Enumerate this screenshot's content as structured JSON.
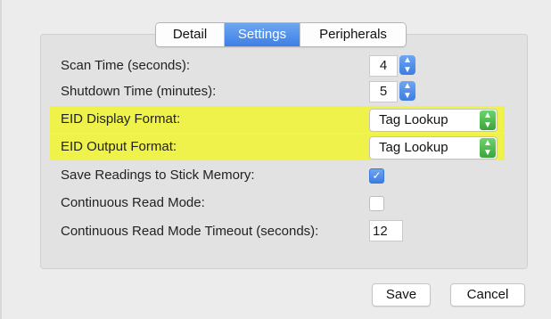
{
  "tabs": [
    {
      "label": "Detail",
      "active": false
    },
    {
      "label": "Settings",
      "active": true
    },
    {
      "label": "Peripherals",
      "active": false
    }
  ],
  "settings": {
    "scan_time": {
      "label": "Scan Time (seconds):",
      "value": "4"
    },
    "shutdown_time": {
      "label": "Shutdown Time (minutes):",
      "value": "5"
    },
    "eid_display": {
      "label": "EID Display Format:",
      "value": "Tag Lookup"
    },
    "eid_output": {
      "label": "EID Output Format:",
      "value": "Tag Lookup"
    },
    "save_readings": {
      "label": "Save Readings to Stick Memory:",
      "checked": true
    },
    "continuous_mode": {
      "label": "Continuous Read Mode:",
      "checked": false
    },
    "continuous_timeout": {
      "label": "Continuous Read Mode Timeout (seconds):",
      "value": "12"
    }
  },
  "buttons": {
    "save": "Save",
    "cancel": "Cancel"
  },
  "icons": {
    "stepper": "up-down-chevron-icon",
    "popup": "up-down-chevron-icon",
    "check": "checkmark-icon"
  },
  "colors": {
    "highlight": "#eef24a",
    "accent_blue": "#3c7fe6",
    "popup_green": "#3aa53a"
  }
}
